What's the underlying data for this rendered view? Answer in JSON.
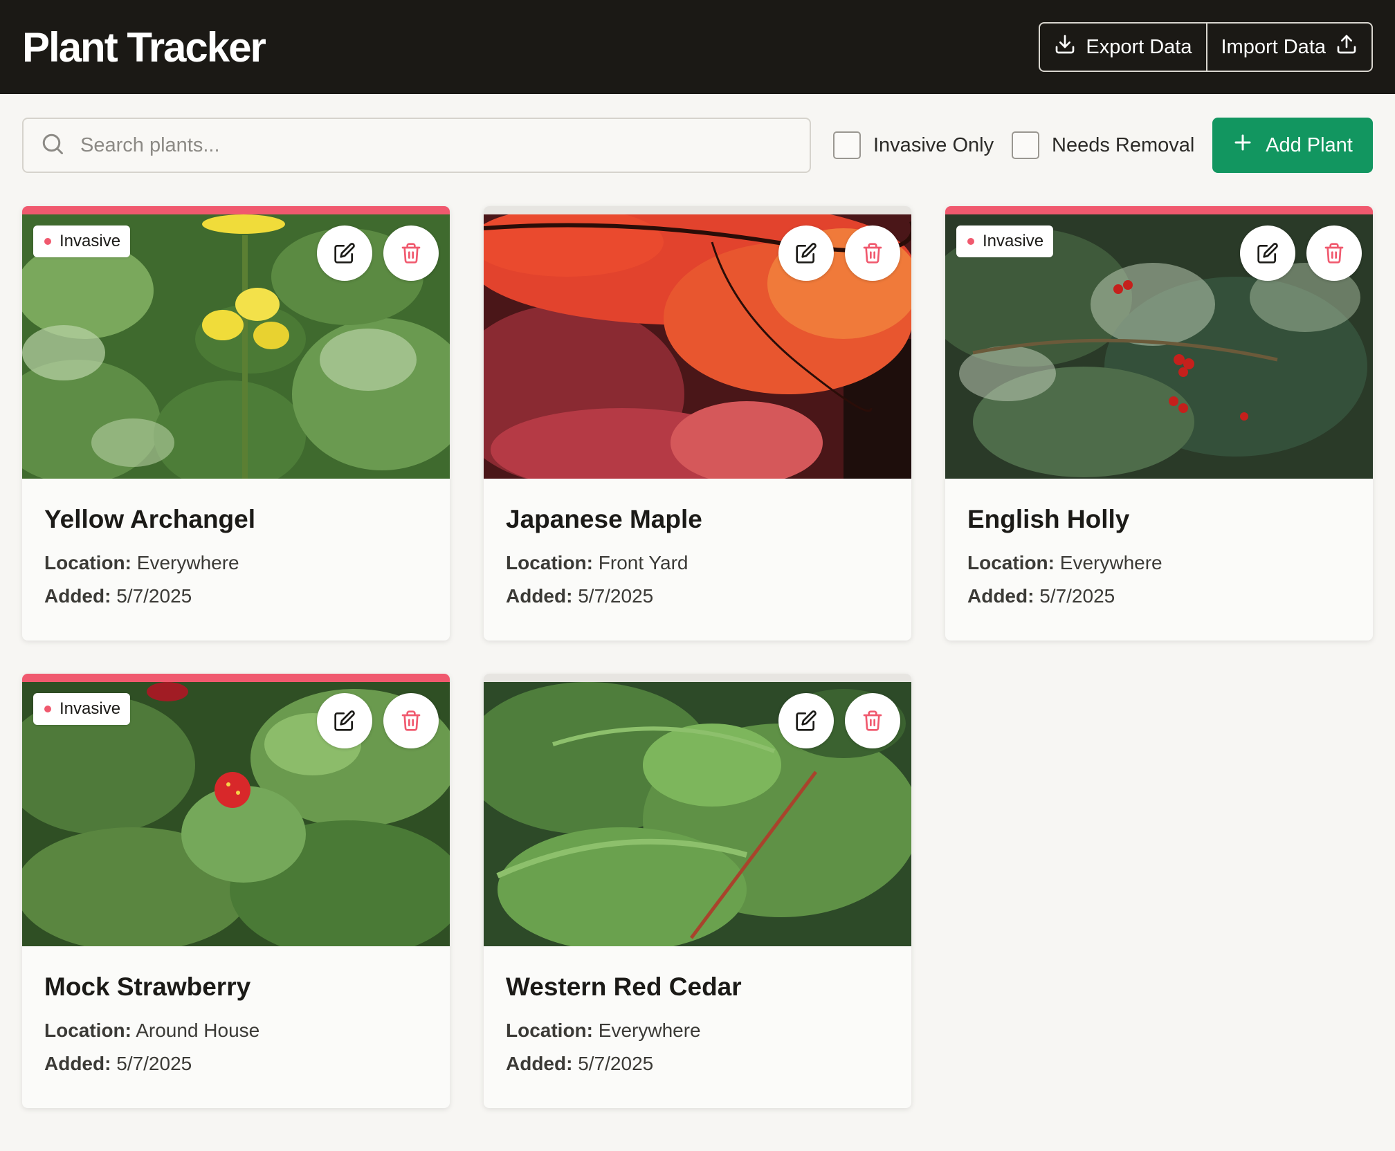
{
  "app": {
    "title": "Plant Tracker",
    "export_label": "Export Data",
    "import_label": "Import Data"
  },
  "toolbar": {
    "search_placeholder": "Search plants...",
    "filter_invasive": "Invasive Only",
    "filter_removal": "Needs Removal",
    "add_label": "Add Plant"
  },
  "labels": {
    "location": "Location:",
    "added": "Added:",
    "invasive_badge": "Invasive"
  },
  "colors": {
    "header_bg": "#1b1915",
    "accent_green": "#129660",
    "invasive_red": "#f0596e"
  },
  "plants": [
    {
      "name": "Yellow Archangel",
      "location": "Everywhere",
      "added": "5/7/2025",
      "invasive": true
    },
    {
      "name": "Japanese Maple",
      "location": "Front Yard",
      "added": "5/7/2025",
      "invasive": false
    },
    {
      "name": "English Holly",
      "location": "Everywhere",
      "added": "5/7/2025",
      "invasive": true
    },
    {
      "name": "Mock Strawberry",
      "location": "Around House",
      "added": "5/7/2025",
      "invasive": true
    },
    {
      "name": "Western Red Cedar",
      "location": "Everywhere",
      "added": "5/7/2025",
      "invasive": false
    }
  ]
}
